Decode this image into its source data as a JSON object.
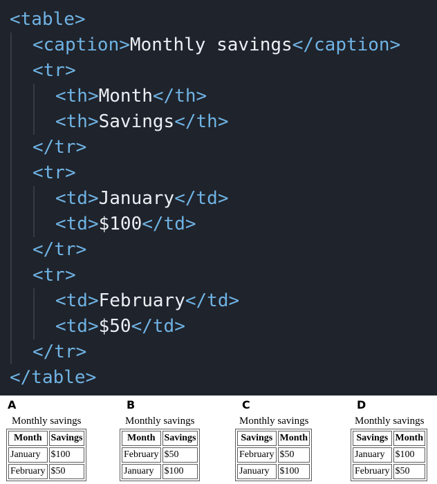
{
  "code": {
    "lines": [
      {
        "parts": [
          {
            "t": "<table>",
            "k": "tag"
          }
        ]
      },
      {
        "parts": [
          {
            "t": "<caption>",
            "k": "tag"
          },
          {
            "t": "Monthly savings",
            "k": "txt"
          },
          {
            "t": "</caption>",
            "k": "tag"
          }
        ]
      },
      {
        "parts": [
          {
            "t": "<tr>",
            "k": "tag"
          }
        ]
      },
      {
        "parts": [
          {
            "t": "<th>",
            "k": "tag"
          },
          {
            "t": "Month",
            "k": "txt"
          },
          {
            "t": "</th>",
            "k": "tag"
          }
        ]
      },
      {
        "parts": [
          {
            "t": "<th>",
            "k": "tag"
          },
          {
            "t": "Savings",
            "k": "txt"
          },
          {
            "t": "</th>",
            "k": "tag"
          }
        ]
      },
      {
        "parts": [
          {
            "t": "</tr>",
            "k": "tag"
          }
        ]
      },
      {
        "parts": [
          {
            "t": "<tr>",
            "k": "tag"
          }
        ]
      },
      {
        "parts": [
          {
            "t": "<td>",
            "k": "tag"
          },
          {
            "t": "January",
            "k": "txt"
          },
          {
            "t": "</td>",
            "k": "tag"
          }
        ]
      },
      {
        "parts": [
          {
            "t": "<td>",
            "k": "tag"
          },
          {
            "t": "$100",
            "k": "txt"
          },
          {
            "t": "</td>",
            "k": "tag"
          }
        ]
      },
      {
        "parts": [
          {
            "t": "</tr>",
            "k": "tag"
          }
        ]
      },
      {
        "parts": [
          {
            "t": "<tr>",
            "k": "tag"
          }
        ]
      },
      {
        "parts": [
          {
            "t": "<td>",
            "k": "tag"
          },
          {
            "t": "February",
            "k": "txt"
          },
          {
            "t": "</td>",
            "k": "tag"
          }
        ]
      },
      {
        "parts": [
          {
            "t": "<td>",
            "k": "tag"
          },
          {
            "t": "$50",
            "k": "txt"
          },
          {
            "t": "</td>",
            "k": "tag"
          }
        ]
      },
      {
        "parts": [
          {
            "t": "</tr>",
            "k": "tag"
          }
        ]
      },
      {
        "parts": [
          {
            "t": "</table>",
            "k": "tag"
          }
        ]
      }
    ],
    "colors": {
      "background": "#1f232b",
      "tag": "#6fb3e4",
      "text": "#eceff4",
      "guide": "#353b46"
    }
  },
  "options": [
    {
      "letter": "A",
      "caption": "Monthly savings",
      "headers": [
        "Month",
        "Savings"
      ],
      "rows": [
        [
          "January",
          "$100"
        ],
        [
          "February",
          "$50"
        ]
      ]
    },
    {
      "letter": "B",
      "caption": "Monthly savings",
      "headers": [
        "Month",
        "Savings"
      ],
      "rows": [
        [
          "February",
          "$50"
        ],
        [
          "January",
          "$100"
        ]
      ]
    },
    {
      "letter": "C",
      "caption": "Monthly savings",
      "headers": [
        "Savings",
        "Month"
      ],
      "rows": [
        [
          "February",
          "$50"
        ],
        [
          "January",
          "$100"
        ]
      ]
    },
    {
      "letter": "D",
      "caption": "Monthly savings",
      "headers": [
        "Savings",
        "Month"
      ],
      "rows": [
        [
          "January",
          "$100"
        ],
        [
          "February",
          "$50"
        ]
      ]
    }
  ]
}
